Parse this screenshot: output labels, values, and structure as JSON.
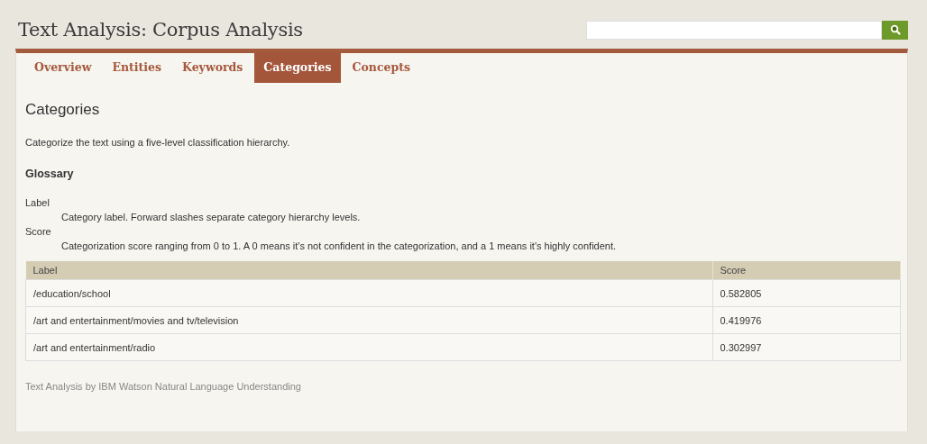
{
  "header": {
    "title": "Text Analysis: Corpus Analysis"
  },
  "tabs": [
    {
      "label": "Overview",
      "selected": false
    },
    {
      "label": "Entities",
      "selected": false
    },
    {
      "label": "Keywords",
      "selected": false
    },
    {
      "label": "Categories",
      "selected": true
    },
    {
      "label": "Concepts",
      "selected": false
    }
  ],
  "section": {
    "heading": "Categories",
    "description": "Categorize the text using a five-level classification hierarchy.",
    "glossary_heading": "Glossary",
    "glossary": [
      {
        "term": "Label",
        "definition": "Category label. Forward slashes separate category hierarchy levels."
      },
      {
        "term": "Score",
        "definition": "Categorization score ranging from 0 to 1. A 0 means it's not confident in the categorization, and a 1 means it's highly confident."
      }
    ]
  },
  "table": {
    "columns": [
      "Label",
      "Score"
    ],
    "rows": [
      [
        "/education/school",
        "0.582805"
      ],
      [
        "/art and entertainment/movies and tv/television",
        "0.419976"
      ],
      [
        "/art and entertainment/radio",
        "0.302997"
      ]
    ]
  },
  "footer": "Text Analysis by IBM Watson Natural Language Understanding"
}
